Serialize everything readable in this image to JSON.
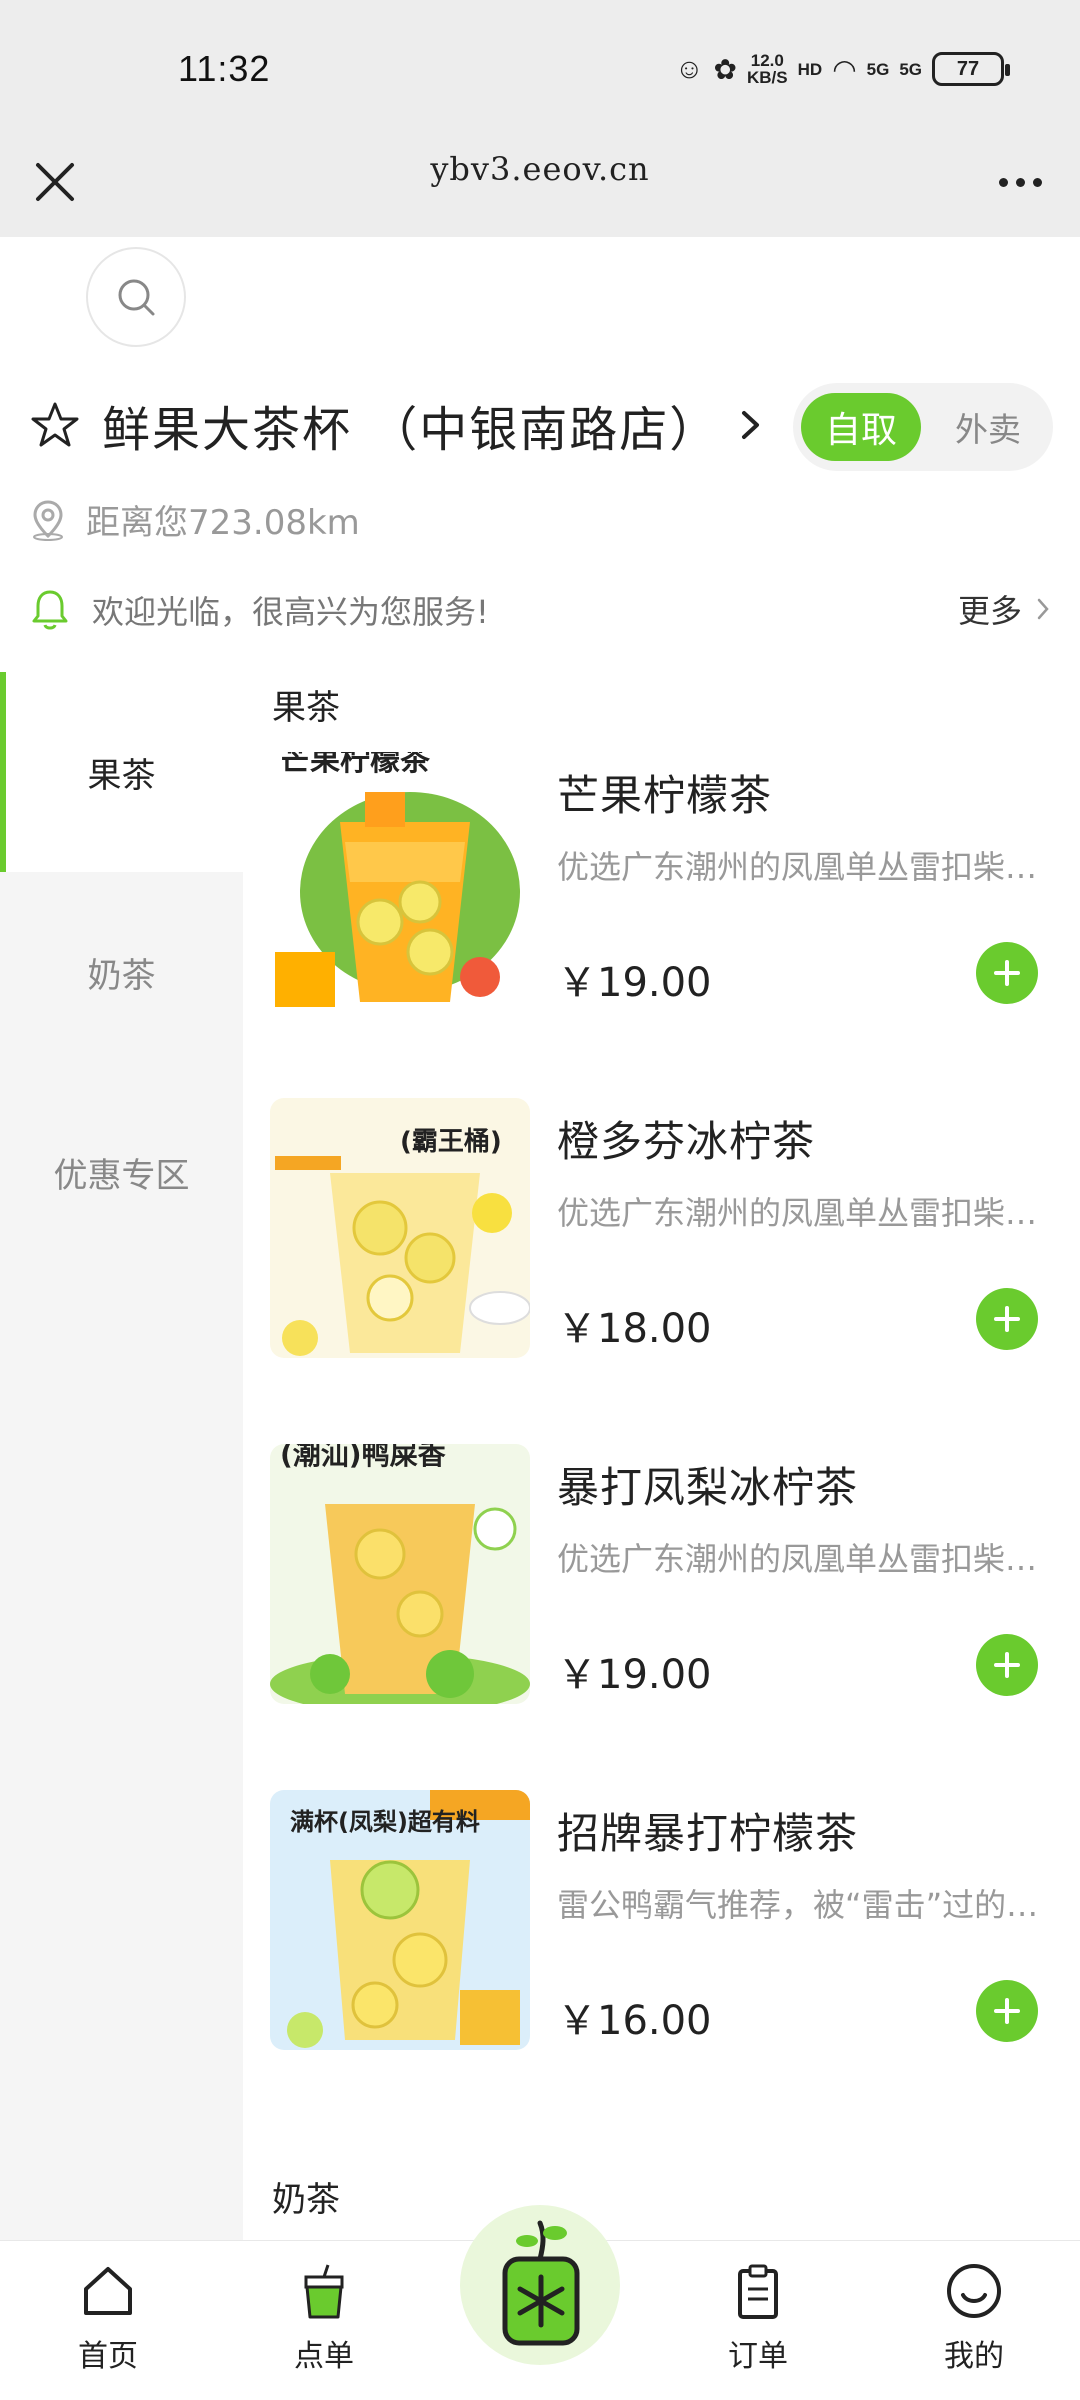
{
  "status_bar": {
    "time": "11:32",
    "net_speed_value": "12.0",
    "net_speed_unit": "KB/S",
    "hd_label": "HD",
    "signal1_label": "5G",
    "signal2_label": "5G",
    "battery": "77"
  },
  "browser": {
    "url": "ybv3.eeov.cn"
  },
  "store": {
    "name": "鲜果大茶杯 （中银南路店）",
    "distance": "距离您723.08km",
    "notice": "欢迎光临，很高兴为您服务!",
    "more_label": "更多",
    "mode_pickup": "自取",
    "mode_delivery": "外卖"
  },
  "categories": [
    {
      "label": "果茶",
      "active": true
    },
    {
      "label": "奶茶",
      "active": false
    },
    {
      "label": "优惠专区",
      "active": false
    }
  ],
  "sections": {
    "fruit_tea_title": "果茶",
    "milk_tea_title": "奶茶"
  },
  "products": [
    {
      "name": "芒果柠檬茶",
      "desc": "优选广东潮州的凤凰单丛雷扣柴…",
      "price": "￥19.00",
      "img_caption": "芒果柠檬茶"
    },
    {
      "name": "橙多芬冰柠茶",
      "desc": "优选广东潮州的凤凰单丛雷扣柴…",
      "price": "￥18.00",
      "img_caption": "(霸王桶)"
    },
    {
      "name": "暴打凤梨冰柠茶",
      "desc": "优选广东潮州的凤凰单丛雷扣柴…",
      "price": "￥19.00",
      "img_caption": "(潮汕)鸭屎香"
    },
    {
      "name": "招牌暴打柠檬茶",
      "desc": "雷公鸭霸气推荐，被“雷击”过的…",
      "price": "￥16.00",
      "img_caption": "满杯(凤梨)超有料"
    }
  ],
  "tabbar": {
    "home": "首页",
    "order": "点单",
    "orders": "订单",
    "mine": "我的"
  },
  "colors": {
    "accent": "#6acb2e",
    "text": "#222222",
    "muted": "#999999",
    "sidebar_bg": "#f5f5f5"
  }
}
